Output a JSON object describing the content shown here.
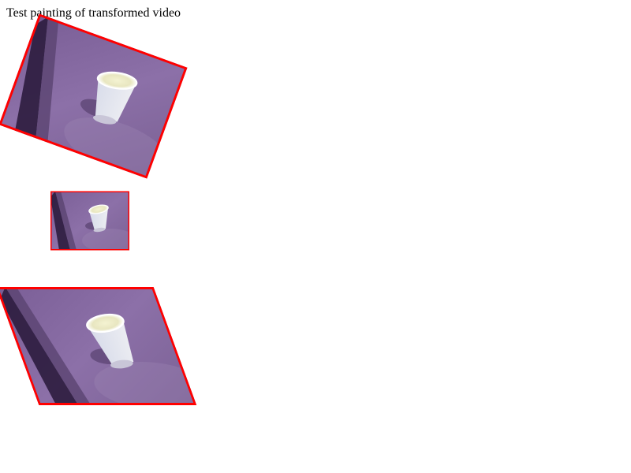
{
  "page": {
    "title": "Test painting of transformed video"
  },
  "videos": [
    {
      "transform": "rotate",
      "angle_deg": 20
    },
    {
      "transform": "scale",
      "factor": 0.5
    },
    {
      "transform": "skewX",
      "angle_deg": 20
    }
  ],
  "colors": {
    "page_background": "#ffffff",
    "video_border": "#ff0000",
    "wall_purple": "#8a6ea6",
    "cup_white": "#eef0e2"
  }
}
